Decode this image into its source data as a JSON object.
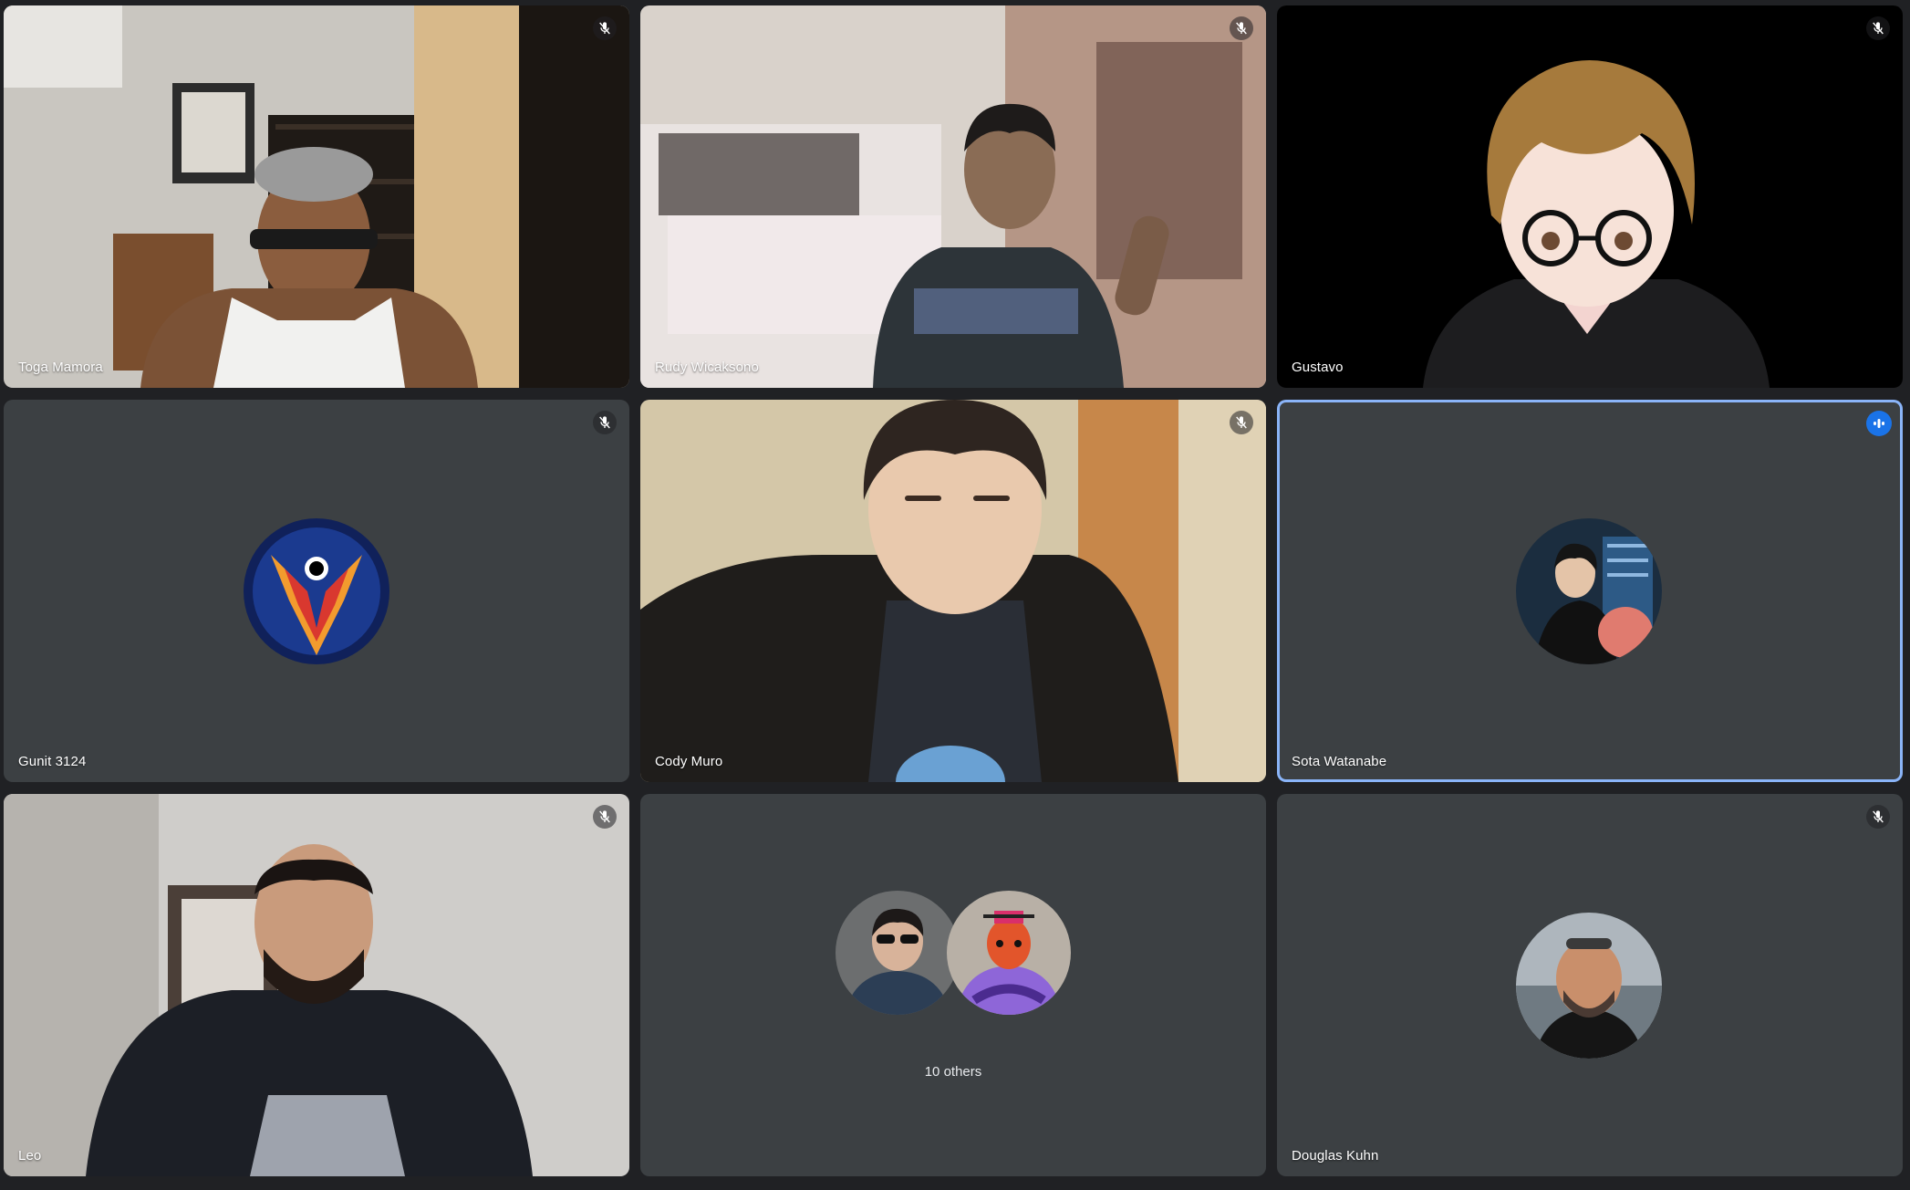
{
  "participants": [
    {
      "name": "Toga Mamora",
      "muted": true
    },
    {
      "name": "Rudy Wicaksono",
      "muted": true
    },
    {
      "name": "Gustavo",
      "muted": true
    },
    {
      "name": "Gunit 3124",
      "muted": true
    },
    {
      "name": "Cody Muro",
      "muted": true
    },
    {
      "name": "Sota Watanabe",
      "muted": false,
      "speaking": true
    },
    {
      "name": "Leo",
      "muted": true
    },
    {
      "name": "Douglas Kuhn",
      "muted": true
    }
  ],
  "others": {
    "label": "10 others"
  },
  "colors": {
    "tile_bg": "#3c4043",
    "page_bg": "#202124",
    "speaking_accent": "#1a73e8",
    "active_border": "#8ab4f8"
  },
  "icons": {
    "muted": "mic-off-icon",
    "speaking": "audio-level-icon"
  }
}
